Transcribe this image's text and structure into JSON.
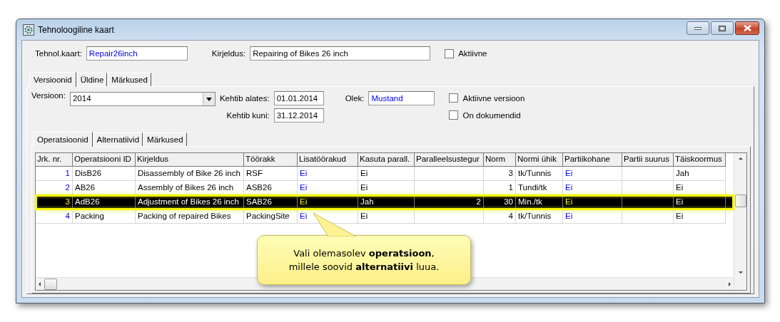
{
  "window": {
    "title": "Tehnoloogiline kaart"
  },
  "header": {
    "card_label": "Tehnol.kaart:",
    "card_value": "Repair26inch",
    "description_label": "Kirjeldus:",
    "description_value": "Repairing of Bikes 26 inch",
    "active": {
      "label": "Aktiivne",
      "checked": false
    }
  },
  "tabs": [
    {
      "label": "Versioonid",
      "selected": true
    },
    {
      "label": "Üldine",
      "selected": false
    },
    {
      "label": "Märkused",
      "selected": false
    }
  ],
  "version": {
    "version_label": "Versioon:",
    "version_value": "2014",
    "valid_from_label": "Kehtib alates:",
    "valid_from": "01.01.2014",
    "valid_to_label": "Kehtib kuni:",
    "valid_to": "31.12.2014",
    "status_label": "Olek:",
    "status_value": "Mustand",
    "checkboxes": [
      {
        "label": "Aktiivne versioon",
        "checked": false
      },
      {
        "label": "On dokumendid",
        "checked": false
      }
    ]
  },
  "subtabs": [
    {
      "label": "Operatsioonid",
      "selected": true
    },
    {
      "label": "Alternatiivid",
      "selected": false
    },
    {
      "label": "Märkused",
      "selected": false
    }
  ],
  "table": {
    "columns": [
      {
        "label": "Jrk. nr.",
        "kind": "index"
      },
      {
        "label": "Operatsiooni ID",
        "kind": "text"
      },
      {
        "label": "Kirjeldus",
        "kind": "text"
      },
      {
        "label": "Töörakk",
        "kind": "text"
      },
      {
        "label": "Lisatöörakud",
        "kind": "flag"
      },
      {
        "label": "Kasuta parall.",
        "kind": "text"
      },
      {
        "label": "Paralleelsustegur",
        "kind": "number"
      },
      {
        "label": "Norm",
        "kind": "number"
      },
      {
        "label": "Normi ühik",
        "kind": "text"
      },
      {
        "label": "Partiikohane",
        "kind": "flag"
      },
      {
        "label": "Partii suurus",
        "kind": "number"
      },
      {
        "label": "Täiskoormus",
        "kind": "text"
      }
    ],
    "rows": [
      {
        "selected": false,
        "cells": [
          "1",
          "DisB26",
          "Disassembly of Bike 26 inch",
          "RSF",
          "Ei",
          "Ei",
          "",
          "3",
          "tk/Tunnis",
          "Ei",
          "",
          "Jah"
        ]
      },
      {
        "selected": false,
        "cells": [
          "2",
          "AB26",
          "Assembly of Bikes 26 inch",
          "ASB26",
          "Ei",
          "Ei",
          "",
          "1",
          "Tundi/tk",
          "Ei",
          "",
          "Ei"
        ]
      },
      {
        "selected": true,
        "cells": [
          "3",
          "AdB26",
          "Adjustment of Bikes 26 inch",
          "SAB26",
          "Ei",
          "Jah",
          "2",
          "30",
          "Min./tk",
          "Ei",
          "",
          "Ei"
        ]
      },
      {
        "selected": false,
        "cells": [
          "4",
          "Packing",
          "Packing of repaired Bikes",
          "PackingSite",
          "Ei",
          "Ei",
          "",
          "4",
          "tk/Tunnis",
          "Ei",
          "",
          "Ei"
        ]
      }
    ]
  },
  "callout": {
    "text": "Vali olemasolev **operatsioon**, millele soovid **alternatiivi** luua."
  }
}
